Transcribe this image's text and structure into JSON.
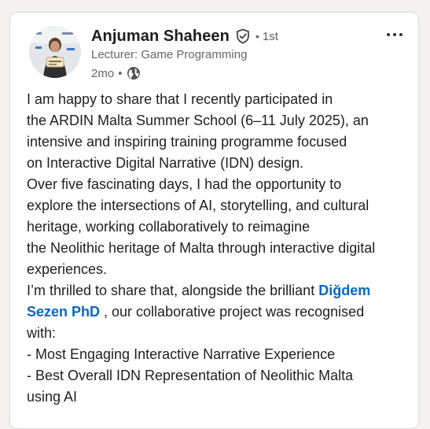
{
  "post": {
    "author": {
      "name": "Anjuman Shaheen",
      "separator": "•",
      "degree": "1st",
      "headline": "Lecturer: Game Programming",
      "time": "2mo",
      "time_separator": "•",
      "verified_icon": "verified-shield-icon",
      "visibility_icon": "globe-icon"
    },
    "more_icon": "ellipsis-icon",
    "body": {
      "l1": "I am happy to share that I recently participated in",
      "l2": "the ARDIN Malta Summer School (6–11 July 2025), an",
      "l3": "intensive and inspiring training programme focused",
      "l4": "on Interactive Digital Narrative (IDN) design.",
      "l5": "Over five fascinating days, I had the opportunity to",
      "l6": "explore the intersections of AI, storytelling, and cultural",
      "l7": "heritage, working collaboratively to reimagine",
      "l8": "the Neolithic heritage of Malta through interactive digital",
      "l9": "experiences.",
      "l10_pre": "I’m thrilled to share that, alongside the brilliant ",
      "mention_part1": "Diğdem",
      "mention_part2": "Sezen PhD",
      "l11_post": " , our collaborative project was recognised",
      "l12": "with:",
      "l13": "- Most Engaging Interactive Narrative Experience",
      "l14": "- Best Overall IDN Representation of Neolithic Malta",
      "l15": "using AI"
    }
  },
  "colors": {
    "mention": "#0a66c2",
    "text": "#1f1f1f",
    "secondary": "#666666"
  }
}
